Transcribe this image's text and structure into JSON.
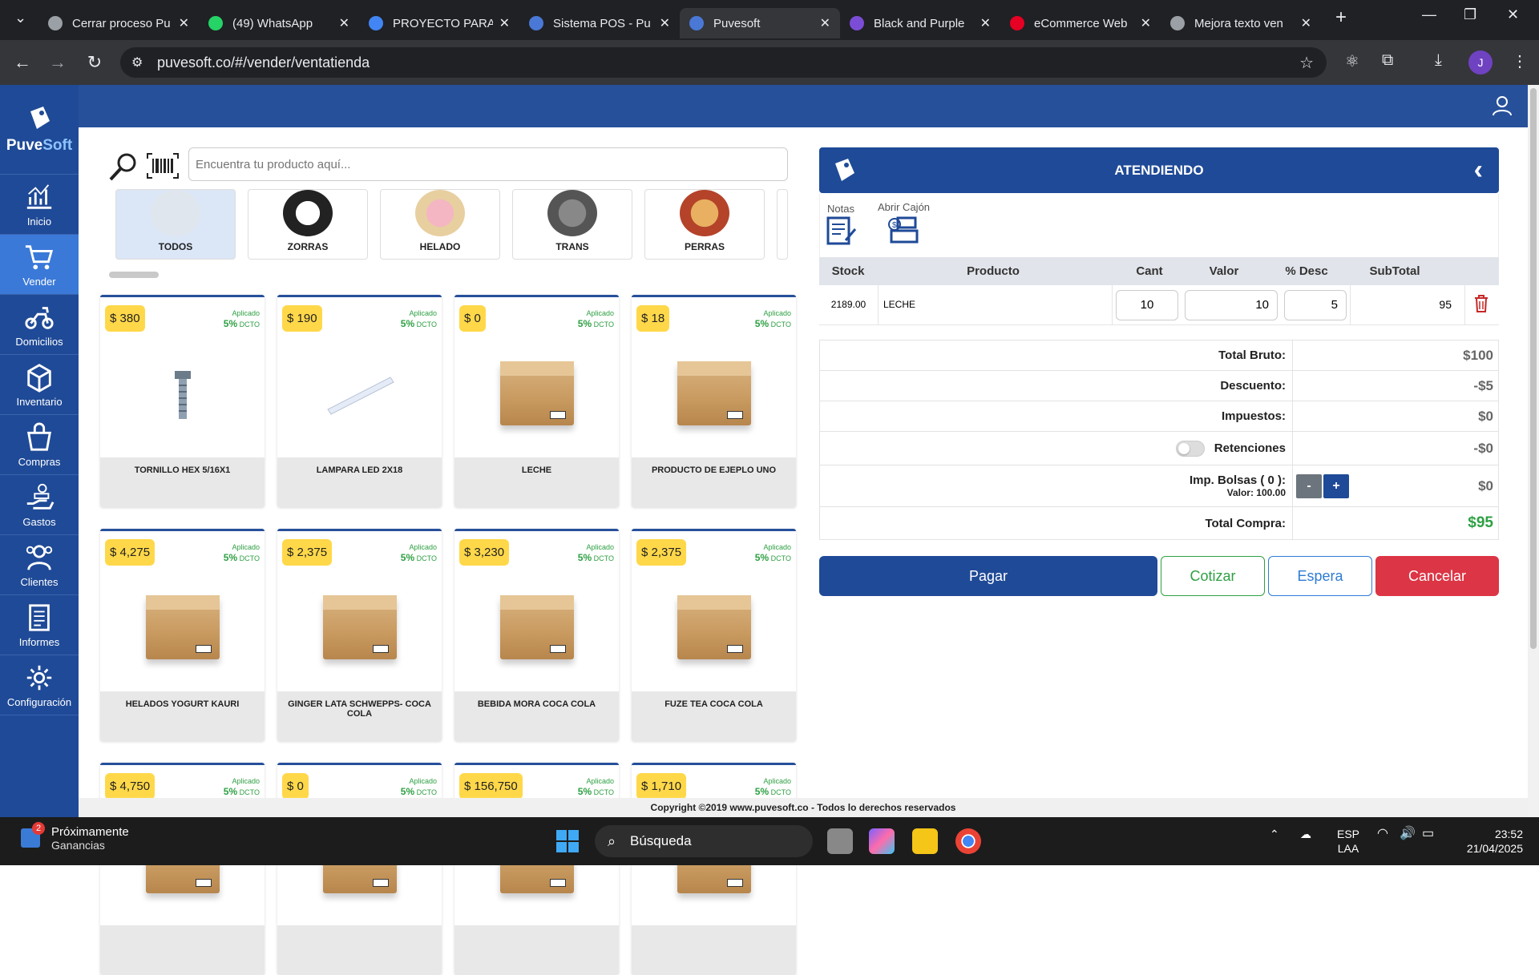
{
  "browser": {
    "tabs": [
      {
        "label": "Cerrar proceso Pu",
        "color": "#9aa0a6"
      },
      {
        "label": "(49) WhatsApp",
        "color": "#25d366"
      },
      {
        "label": "PROYECTO PARA",
        "color": "#4285f4"
      },
      {
        "label": "Sistema POS - Pu",
        "color": "#4a78d6"
      },
      {
        "label": "Puvesoft",
        "color": "#4a78d6"
      },
      {
        "label": "Black and Purple",
        "color": "#7b4dd6"
      },
      {
        "label": "eCommerce Web",
        "color": "#e60023"
      },
      {
        "label": "Mejora texto ven",
        "color": "#9aa0a6"
      }
    ],
    "url": "puvesoft.co/#/vender/ventatienda",
    "avatar_letter": "J"
  },
  "app": {
    "logo": {
      "part1": "Puve",
      "part2": "Soft"
    },
    "nav": [
      {
        "label": "Inicio",
        "icon": "chart-icon"
      },
      {
        "label": "Vender",
        "icon": "cart-icon",
        "active": true
      },
      {
        "label": "Domicilios",
        "icon": "scooter-icon"
      },
      {
        "label": "Inventario",
        "icon": "box-icon"
      },
      {
        "label": "Compras",
        "icon": "bag-icon"
      },
      {
        "label": "Gastos",
        "icon": "money-hand-icon"
      },
      {
        "label": "Clientes",
        "icon": "users-icon"
      },
      {
        "label": "Informes",
        "icon": "report-icon"
      },
      {
        "label": "Configuración",
        "icon": "gear-icon"
      }
    ],
    "search": {
      "placeholder": "Encuentra tu producto aquí..."
    },
    "categories": [
      "TODOS",
      "ZORRAS",
      "HELADO",
      "TRANS",
      "PERRAS"
    ],
    "products": [
      {
        "price": "$ 380",
        "name": "TORNILLO HEX 5/16X1",
        "img": "screw"
      },
      {
        "price": "$ 190",
        "name": "LAMPARA LED 2X18",
        "img": "lamp"
      },
      {
        "price": "$ 0",
        "name": "LECHE",
        "img": "box"
      },
      {
        "price": "$ 18",
        "name": "PRODUCTO DE EJEPLO UNO",
        "img": "box"
      },
      {
        "price": "$ 4,275",
        "name": "HELADOS YOGURT KAURI",
        "img": "box"
      },
      {
        "price": "$ 2,375",
        "name": "GINGER LATA SCHWEPPS- COCA COLA",
        "img": "box"
      },
      {
        "price": "$ 3,230",
        "name": "BEBIDA MORA COCA COLA",
        "img": "box"
      },
      {
        "price": "$ 2,375",
        "name": "FUZE TEA COCA COLA",
        "img": "box"
      },
      {
        "price": "$ 4,750",
        "name": "",
        "img": "box"
      },
      {
        "price": "$ 0",
        "name": "",
        "img": "box"
      },
      {
        "price": "$ 156,750",
        "name": "",
        "img": "box"
      },
      {
        "price": "$ 1,710",
        "name": "",
        "img": "box"
      }
    ],
    "dcto": {
      "applied": "Aplicado",
      "pct": "5%",
      "word": "DCTO"
    },
    "panel": {
      "title": "ATENDIENDO",
      "notes_label": "Notas",
      "drawer_label": "Abrir Cajón",
      "columns": [
        "Stock",
        "Producto",
        "Cant",
        "Valor",
        "% Desc",
        "SubTotal"
      ],
      "row": {
        "stock": "2189.00",
        "product": "LECHE",
        "qty": "10",
        "value": "10",
        "desc": "5",
        "subtotal": "95"
      },
      "summary": {
        "gross_label": "Total Bruto:",
        "gross": "$100",
        "disc_label": "Descuento:",
        "disc": "-$5",
        "tax_label": "Impuestos:",
        "tax": "$0",
        "ret_label": "Retenciones",
        "ret": "-$0",
        "bags_label": "Imp. Bolsas ( 0 ):",
        "bags_value_label": "Valor: 100.00",
        "bags": "$0",
        "minus": "-",
        "plus": "+",
        "total_label": "Total Compra:",
        "total": "$95"
      },
      "buttons": {
        "pay": "Pagar",
        "quote": "Cotizar",
        "wait": "Espera",
        "cancel": "Cancelar"
      }
    },
    "footer": "Copyright ©2019 www.puvesoft.co - Todos lo derechos reservados"
  },
  "taskbar": {
    "widget_title": "Próximamente",
    "widget_sub": "Ganancias",
    "badge": "2",
    "search": "Búsqueda",
    "lang1": "ESP",
    "lang2": "LAA",
    "time": "23:52",
    "date": "21/04/2025"
  }
}
